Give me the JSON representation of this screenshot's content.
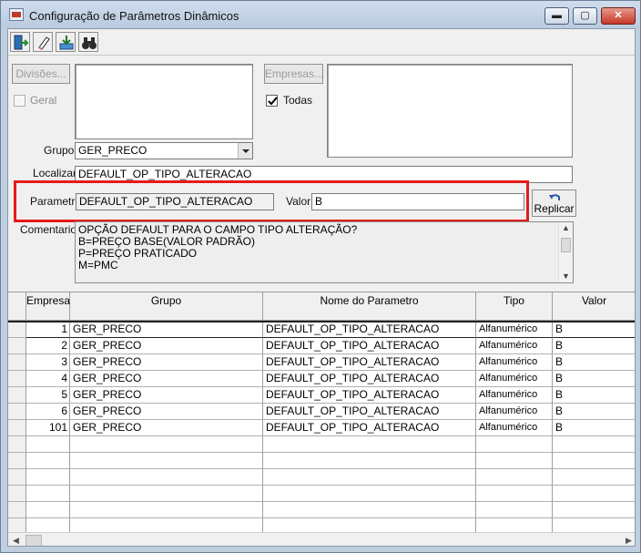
{
  "window": {
    "title": "Configuração de Parâmetros Dinâmicos",
    "min_label": "▬",
    "max_label": "▢",
    "close_label": "✕"
  },
  "toolbar": {
    "icons": [
      "exit-icon",
      "eraser-icon",
      "import-icon",
      "binoculars-icon"
    ]
  },
  "form": {
    "divisoes_button": "Divisões...",
    "geral_label": "Geral",
    "geral_checked": false,
    "empresas_button": "Empresas...",
    "todas_label": "Todas",
    "todas_checked": true,
    "grupo_label": "Grupo",
    "grupo_value": "GER_PRECO",
    "localizar_label": "Localizar",
    "localizar_value": "DEFAULT_OP_TIPO_ALTERACAO",
    "parametro_label": "Parametro",
    "parametro_value": "DEFAULT_OP_TIPO_ALTERACAO",
    "valor_label": "Valor",
    "valor_value": "B",
    "replicar_label": "Replicar",
    "comentarios_label": "Comentarios",
    "comentarios_lines": [
      "OPÇÃO DEFAULT PARA O CAMPO TIPO ALTERAÇÃO?",
      "B=PREÇO BASE(VALOR PADRÃO)",
      "P=PREÇO PRATICADO",
      "M=PMC"
    ]
  },
  "grid": {
    "columns": [
      "Empresa",
      "Grupo",
      "Nome do Parametro",
      "Tipo",
      "Valor"
    ],
    "rows": [
      {
        "empresa": "1",
        "grupo": "GER_PRECO",
        "nome": "DEFAULT_OP_TIPO_ALTERACAO",
        "tipo": "Alfanumérico",
        "valor": "B"
      },
      {
        "empresa": "2",
        "grupo": "GER_PRECO",
        "nome": "DEFAULT_OP_TIPO_ALTERACAO",
        "tipo": "Alfanumérico",
        "valor": "B"
      },
      {
        "empresa": "3",
        "grupo": "GER_PRECO",
        "nome": "DEFAULT_OP_TIPO_ALTERACAO",
        "tipo": "Alfanumérico",
        "valor": "B"
      },
      {
        "empresa": "4",
        "grupo": "GER_PRECO",
        "nome": "DEFAULT_OP_TIPO_ALTERACAO",
        "tipo": "Alfanumérico",
        "valor": "B"
      },
      {
        "empresa": "5",
        "grupo": "GER_PRECO",
        "nome": "DEFAULT_OP_TIPO_ALTERACAO",
        "tipo": "Alfanumérico",
        "valor": "B"
      },
      {
        "empresa": "6",
        "grupo": "GER_PRECO",
        "nome": "DEFAULT_OP_TIPO_ALTERACAO",
        "tipo": "Alfanumérico",
        "valor": "B"
      },
      {
        "empresa": "101",
        "grupo": "GER_PRECO",
        "nome": "DEFAULT_OP_TIPO_ALTERACAO",
        "tipo": "Alfanumérico",
        "valor": "B"
      }
    ]
  },
  "colors": {
    "highlight": "#e51b1b",
    "titlebar": "#c4d3e6"
  }
}
